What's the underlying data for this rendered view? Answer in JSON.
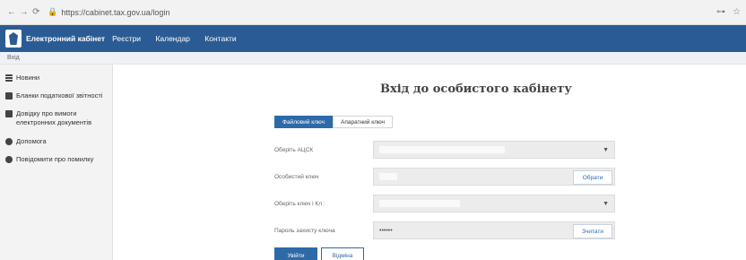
{
  "browser": {
    "url": "https://cabinet.tax.gov.ua/login"
  },
  "header": {
    "brand": "Електронний кабінет",
    "nav": [
      "Реєстри",
      "Календар",
      "Контакти"
    ]
  },
  "breadcrumb": "Вхід",
  "sidebar": {
    "items": [
      {
        "label": "Новини",
        "icon": "news-icon"
      },
      {
        "label": "Бланки податкової звітності",
        "icon": "document-icon"
      },
      {
        "label": "Довідку про вимоги електронних документів",
        "icon": "document-icon"
      },
      {
        "label": "Допомога",
        "icon": "help-icon"
      },
      {
        "label": "Повідомити про помилку",
        "icon": "bug-icon"
      }
    ]
  },
  "main": {
    "title": "Вхід до особистого кабінету",
    "tabs": [
      "Файловий ключ",
      "Апаратний ключ"
    ],
    "form": {
      "acsk_label": "Оберіть АЦСК",
      "key_label": "Особистий ключ",
      "key_button": "Обрати",
      "cert_label": "Оберіть ключ і Кл :",
      "password_label": "Пароль захисту ключа",
      "password_value": "••••••",
      "password_button": "Зчитати"
    },
    "actions": {
      "primary": "Увійти",
      "secondary": "Відміна"
    }
  },
  "colors": {
    "header_bg": "#2b5b94",
    "accent": "#2e6aa8"
  }
}
